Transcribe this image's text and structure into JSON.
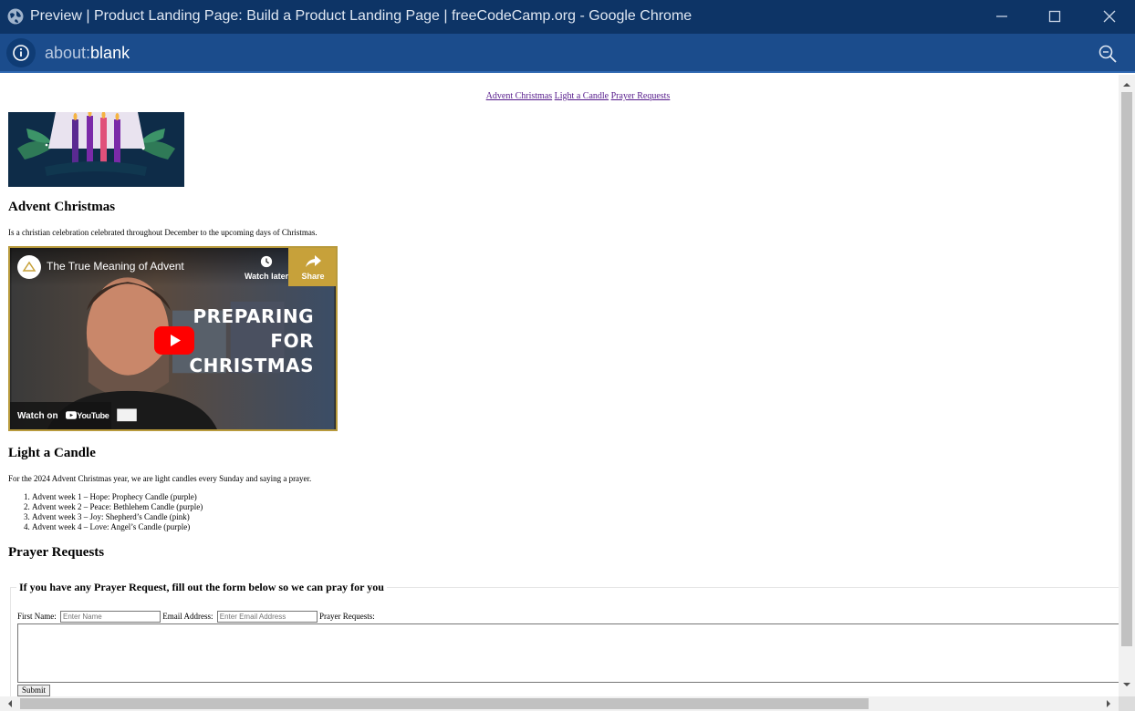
{
  "window": {
    "title": "Preview | Product Landing Page: Build a Product Landing Page | freeCodeCamp.org - Google Chrome",
    "address_scheme": "about:",
    "address_path": "blank"
  },
  "nav": {
    "links": [
      "Advent Christmas",
      "Light a Candle",
      "Prayer Requests"
    ]
  },
  "advent": {
    "heading": "Advent Christmas",
    "description": "Is a christian celebration celebrated throughout December to the upcoming days of Christmas."
  },
  "video": {
    "title": "The True Meaning of Advent",
    "watch_later": "Watch later",
    "share": "Share",
    "overlay_lines": [
      "PREPARING",
      "FOR",
      "CHRISTMAS"
    ],
    "watch_on": "Watch on",
    "youtube": "YouTube"
  },
  "candle": {
    "heading": "Light a Candle",
    "description": "For the 2024 Advent Christmas year, we are light candles every Sunday and saying a prayer.",
    "items": [
      "Advent week 1 – Hope: Prophecy Candle (purple)",
      "Advent week 2 – Peace: Bethlehem Candle (purple)",
      "Advent week 3 – Joy: Shepherd’s Candle (pink)",
      "Advent week 4 – Love: Angel’s Candle (purple)"
    ]
  },
  "prayer": {
    "heading": "Prayer Requests",
    "legend": "If you have any Prayer Request, fill out the form below so we can pray for you",
    "first_name_label": "First Name:",
    "first_name_placeholder": "Enter Name",
    "email_label": "Email Address:",
    "email_placeholder": "Enter Email Address",
    "requests_label": "Prayer Requests:",
    "submit_label": "Submit"
  },
  "colors": {
    "titlebar": "#0d3466",
    "addressbar": "#1b4c8c",
    "visited_link": "#551a8b",
    "candle_purple": "#7b2aa8",
    "candle_pink": "#e0507a",
    "youtube_red": "#ff0000"
  }
}
